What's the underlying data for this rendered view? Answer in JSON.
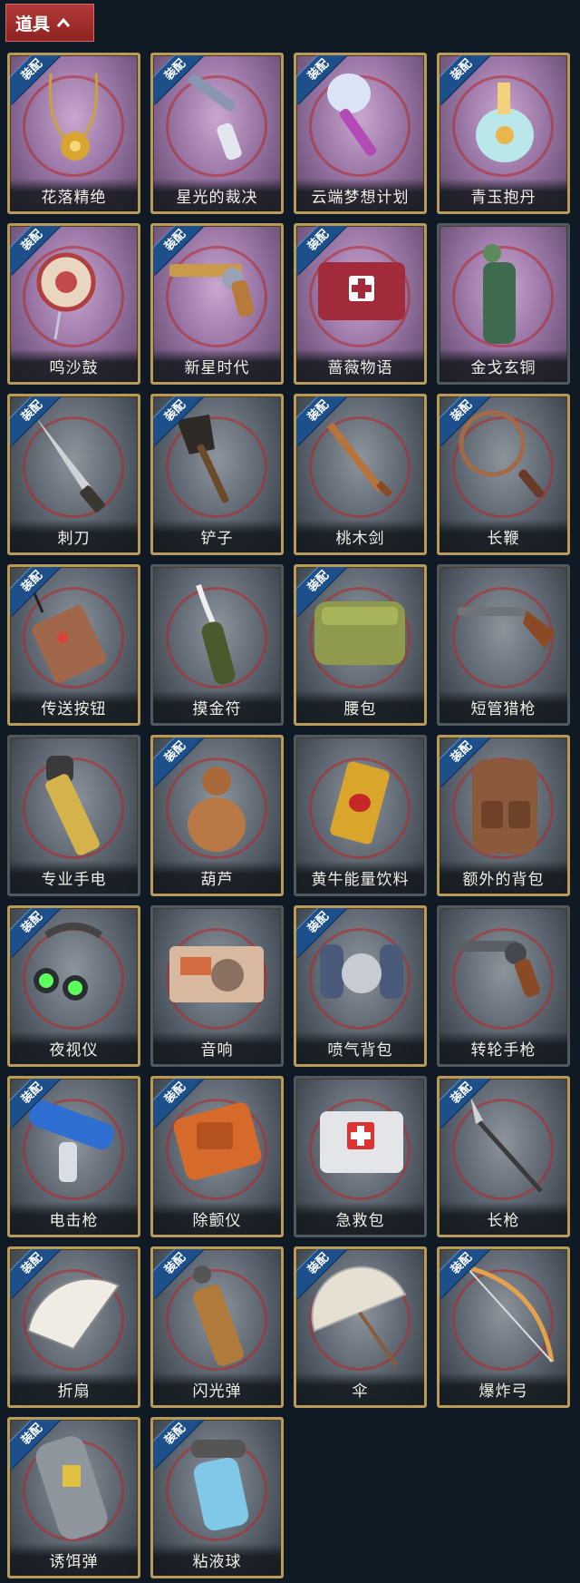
{
  "header": {
    "title": "道具"
  },
  "equip_badge": "装配",
  "items": [
    {
      "name": "花落精绝",
      "equipped": true,
      "tier": "purple",
      "icon": "necklace-icon"
    },
    {
      "name": "星光的裁决",
      "equipped": true,
      "tier": "purple",
      "icon": "flintlock-pistol-icon"
    },
    {
      "name": "云端梦想计划",
      "equipped": true,
      "tier": "purple",
      "icon": "scepter-icon"
    },
    {
      "name": "青玉抱丹",
      "equipped": true,
      "tier": "purple",
      "icon": "jade-vase-icon"
    },
    {
      "name": "鸣沙鼓",
      "equipped": true,
      "tier": "purple",
      "icon": "drum-icon"
    },
    {
      "name": "新星时代",
      "equipped": true,
      "tier": "purple",
      "icon": "golden-revolver-icon"
    },
    {
      "name": "蔷薇物语",
      "equipped": true,
      "tier": "purple",
      "icon": "medkit-bag-icon"
    },
    {
      "name": "金戈玄铜",
      "equipped": false,
      "tier": "purple",
      "icon": "bronze-grenade-icon"
    },
    {
      "name": "刺刀",
      "equipped": true,
      "tier": "gray",
      "icon": "bayonet-icon"
    },
    {
      "name": "铲子",
      "equipped": true,
      "tier": "gray",
      "icon": "shovel-icon"
    },
    {
      "name": "桃木剑",
      "equipped": true,
      "tier": "gray",
      "icon": "wooden-sword-icon"
    },
    {
      "name": "长鞭",
      "equipped": true,
      "tier": "gray",
      "icon": "whip-icon"
    },
    {
      "name": "传送按钮",
      "equipped": true,
      "tier": "gray",
      "icon": "remote-button-icon"
    },
    {
      "name": "摸金符",
      "equipped": false,
      "tier": "gray",
      "icon": "talisman-icon"
    },
    {
      "name": "腰包",
      "equipped": true,
      "tier": "gray",
      "icon": "waist-bag-icon"
    },
    {
      "name": "短管猎枪",
      "equipped": false,
      "tier": "gray",
      "icon": "sawed-off-shotgun-icon"
    },
    {
      "name": "专业手电",
      "equipped": false,
      "tier": "gray",
      "icon": "flashlight-icon"
    },
    {
      "name": "葫芦",
      "equipped": true,
      "tier": "gray",
      "icon": "gourd-icon"
    },
    {
      "name": "黄牛能量饮料",
      "equipped": false,
      "tier": "gray",
      "icon": "energy-drink-icon"
    },
    {
      "name": "额外的背包",
      "equipped": true,
      "tier": "gray",
      "icon": "backpack-icon"
    },
    {
      "name": "夜视仪",
      "equipped": true,
      "tier": "gray",
      "icon": "night-vision-icon"
    },
    {
      "name": "音响",
      "equipped": false,
      "tier": "gray",
      "icon": "radio-icon"
    },
    {
      "name": "喷气背包",
      "equipped": true,
      "tier": "gray",
      "icon": "jetpack-icon"
    },
    {
      "name": "转轮手枪",
      "equipped": false,
      "tier": "gray",
      "icon": "revolver-icon"
    },
    {
      "name": "电击枪",
      "equipped": true,
      "tier": "gray",
      "icon": "stun-gun-icon"
    },
    {
      "name": "除颤仪",
      "equipped": true,
      "tier": "gray",
      "icon": "defibrillator-icon"
    },
    {
      "name": "急救包",
      "equipped": false,
      "tier": "gray",
      "icon": "first-aid-kit-icon"
    },
    {
      "name": "长枪",
      "equipped": true,
      "tier": "gray",
      "icon": "spear-icon"
    },
    {
      "name": "折扇",
      "equipped": true,
      "tier": "gray",
      "icon": "folding-fan-icon"
    },
    {
      "name": "闪光弹",
      "equipped": true,
      "tier": "gray",
      "icon": "flashbang-icon"
    },
    {
      "name": "伞",
      "equipped": true,
      "tier": "gray",
      "icon": "umbrella-icon"
    },
    {
      "name": "爆炸弓",
      "equipped": true,
      "tier": "gray",
      "icon": "bow-icon"
    },
    {
      "name": "诱饵弹",
      "equipped": true,
      "tier": "gray",
      "icon": "decoy-grenade-icon"
    },
    {
      "name": "粘液球",
      "equipped": true,
      "tier": "gray",
      "icon": "slime-ball-icon"
    }
  ]
}
